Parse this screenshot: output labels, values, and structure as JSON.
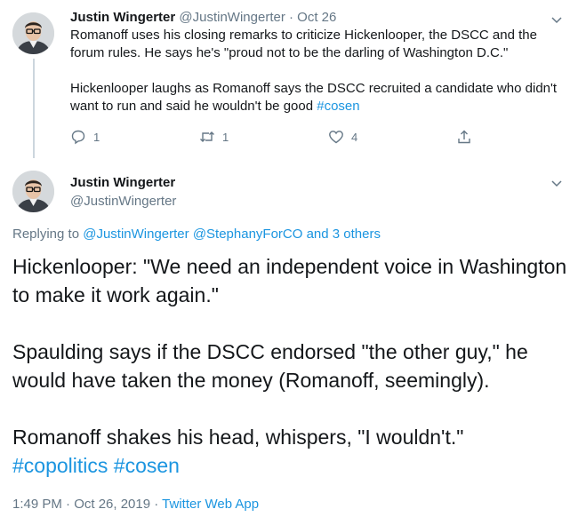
{
  "tweet1": {
    "author_name": "Justin Wingerter",
    "author_handle": "@JustinWingerter",
    "separator": "·",
    "date": "Oct 26",
    "paragraph1": "Romanoff uses his closing remarks to criticize Hickenlooper, the DSCC and the forum rules. He says he's \"proud not to be the darling of Washington D.C.\"",
    "paragraph2_text": "Hickenlooper laughs as Romanoff says the DSCC recruited a candidate who didn't want to run and said he wouldn't be good ",
    "paragraph2_hashtag": "#cosen",
    "reply_count": "1",
    "retweet_count": "1",
    "like_count": "4"
  },
  "tweet2": {
    "author_name": "Justin Wingerter",
    "author_handle": "@JustinWingerter",
    "replying_prefix": "Replying to",
    "replying_users": "@JustinWingerter @StephanyForCO and 3 others",
    "paragraph1": "Hickenlooper: \"We need an independent voice in Washington to make it work again.\"",
    "paragraph2": "Spaulding says if the DSCC endorsed \"the other guy,\" he would have taken the money (Romanoff, seemingly).",
    "paragraph3": "Romanoff shakes his head, whispers, \"I wouldn't.\"",
    "hashtags": "#copolitics #cosen",
    "timestamp": "1:49 PM · Oct 26, 2019",
    "separator": "·",
    "source": "Twitter Web App"
  },
  "colors": {
    "link": "#1b95e0",
    "muted": "#657786",
    "text": "#14171a",
    "thread_line": "#ccd6dd"
  },
  "icons": [
    "reply-icon",
    "retweet-icon",
    "like-icon",
    "share-icon",
    "chevron-down-icon"
  ]
}
